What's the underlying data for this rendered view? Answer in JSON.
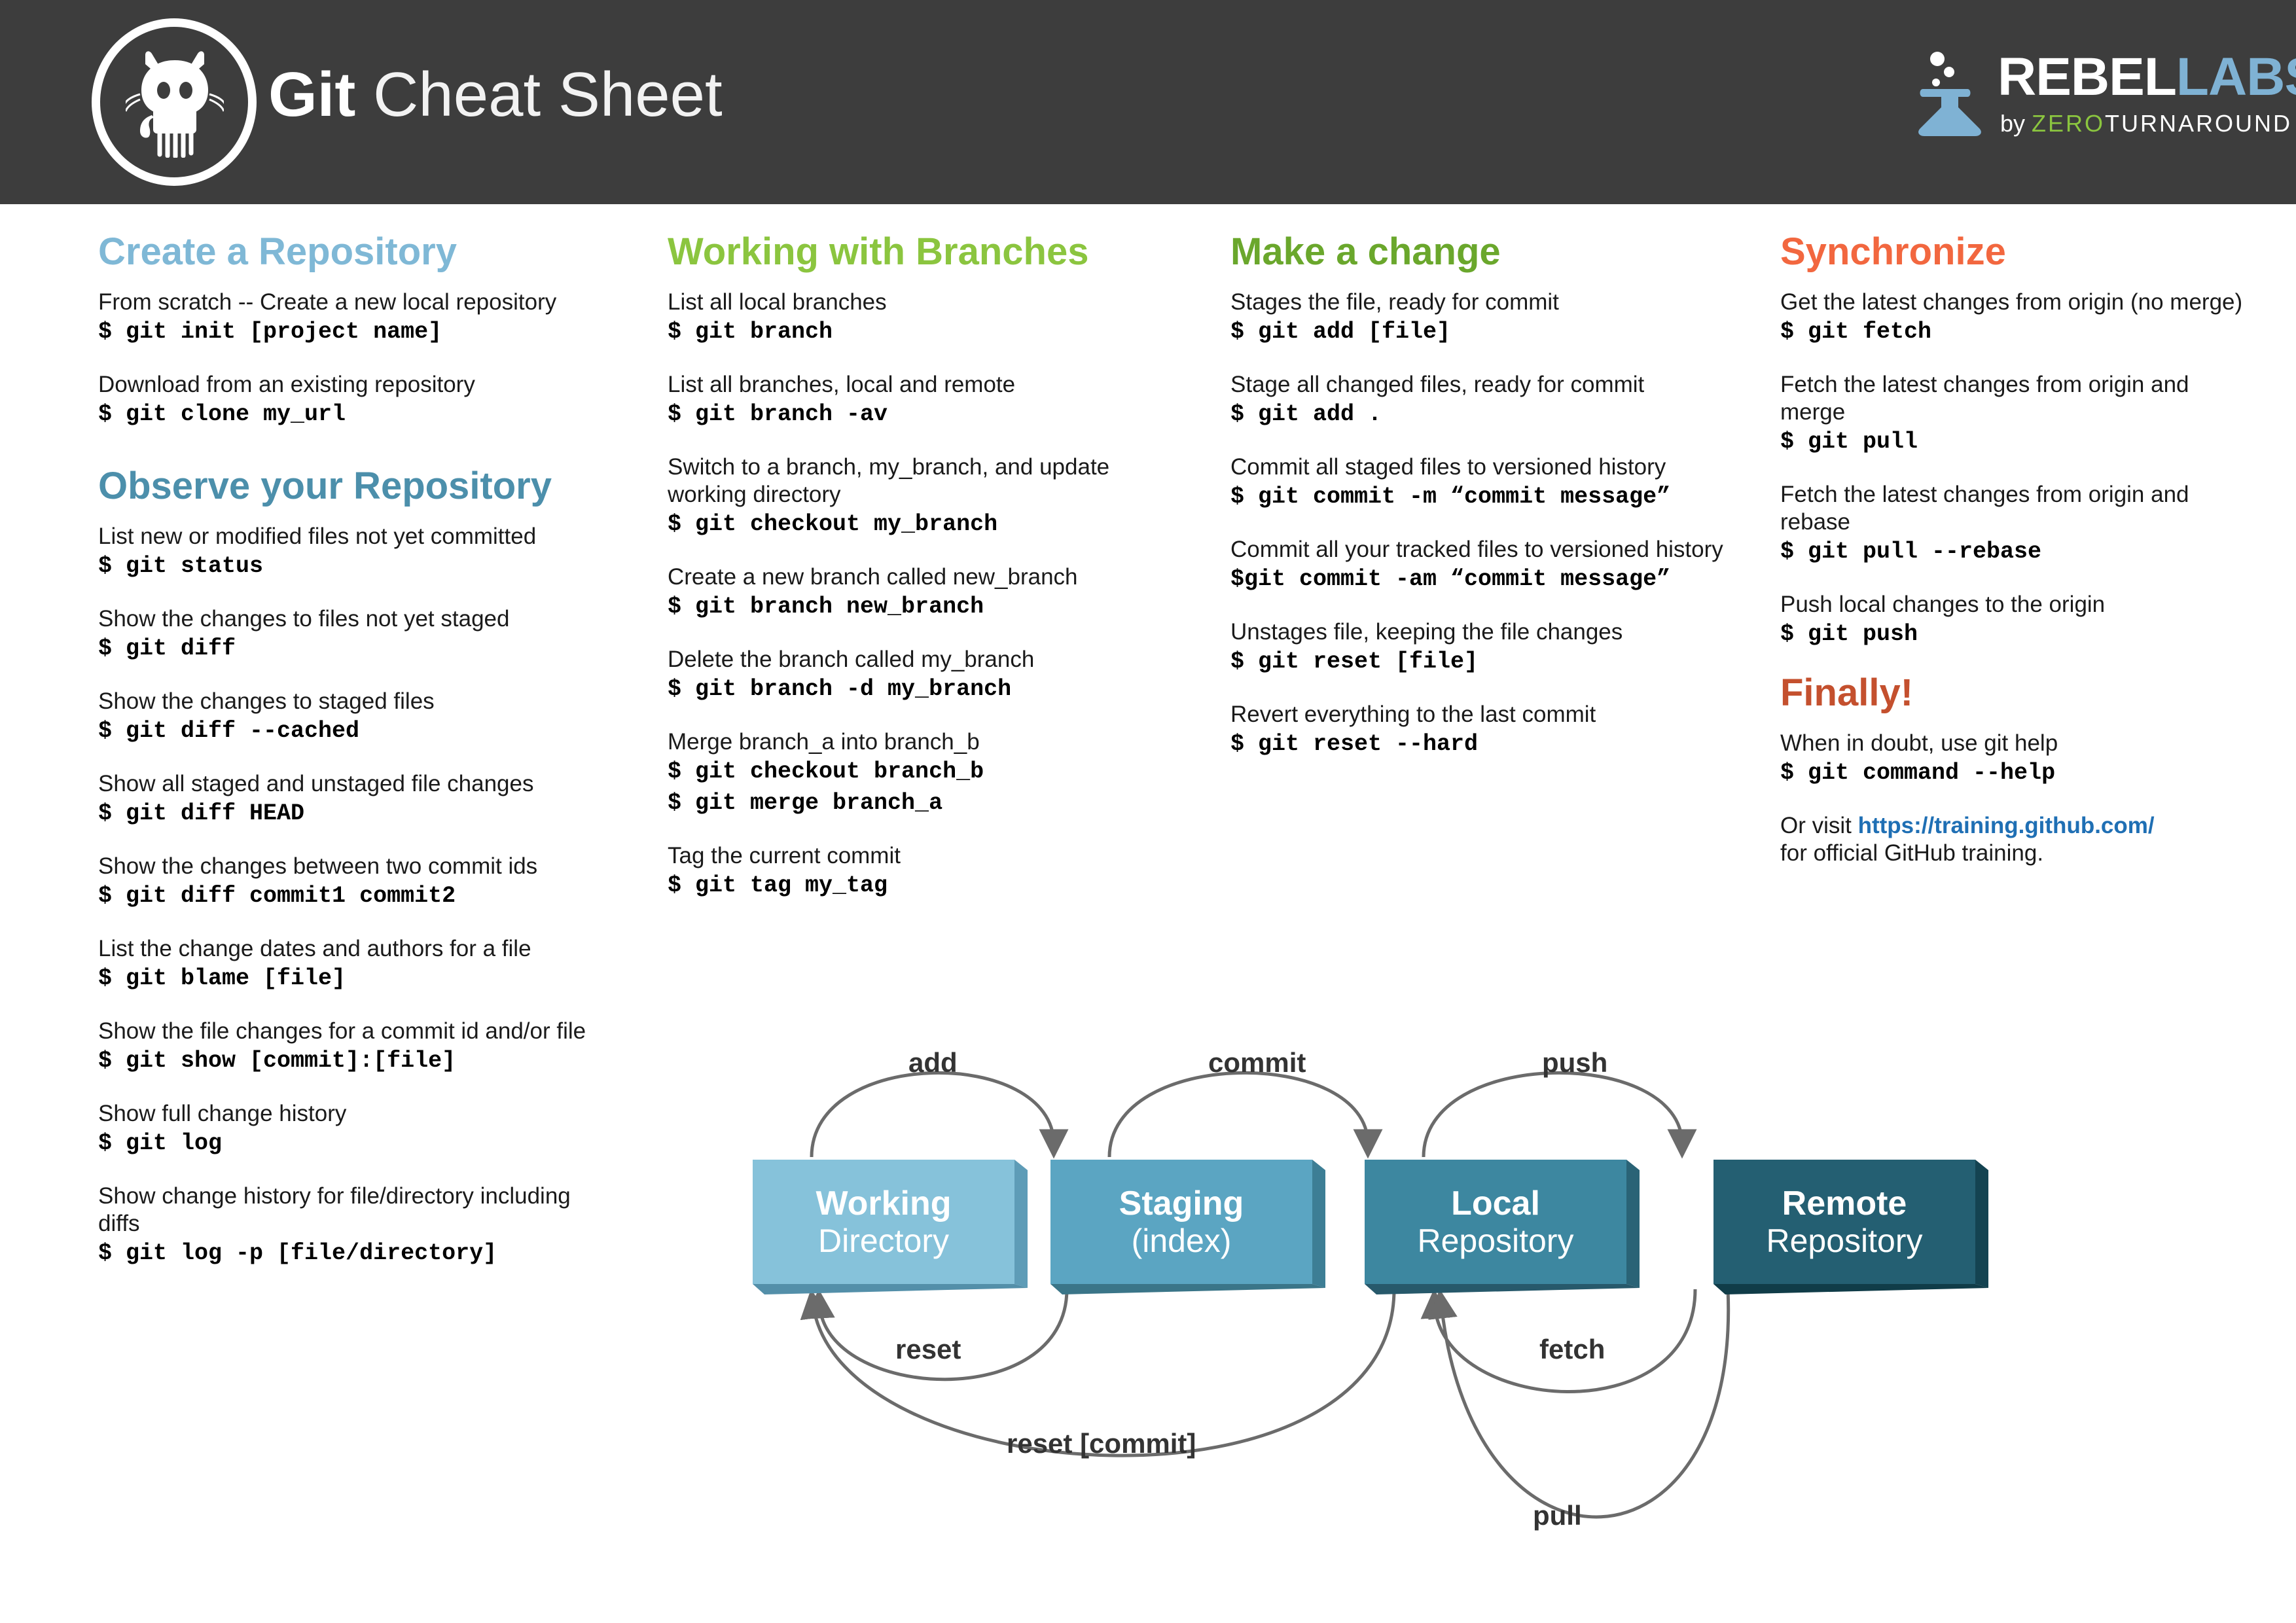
{
  "header": {
    "title_bold": "Git",
    "title_light": " Cheat Sheet",
    "logo_icon": "github-octocat-icon",
    "brand": {
      "rebel": "REBEL",
      "labs": "LABS",
      "by": "by ",
      "zero": "ZERO",
      "turnaround": "TURNAROUND"
    }
  },
  "columns": [
    {
      "id": "create-repository",
      "sections": [
        {
          "heading": "Create a Repository",
          "color": "#7fb8d6",
          "blocks": [
            {
              "desc": "From scratch -- Create a new local repository",
              "cmd": "$ git init [project name]"
            },
            {
              "desc": "Download from an existing repository",
              "cmd": "$ git clone my_url"
            }
          ]
        },
        {
          "heading": "Observe your Repository",
          "color": "#4c8fab",
          "blocks": [
            {
              "desc": "List new or modified files not yet committed",
              "cmd": "$ git status"
            },
            {
              "desc": "Show the changes to files not yet staged",
              "cmd": "$ git diff"
            },
            {
              "desc": "Show the changes to staged files",
              "cmd": "$ git diff --cached"
            },
            {
              "desc": "Show all staged and unstaged file changes",
              "cmd": "$ git diff HEAD"
            },
            {
              "desc": "Show the changes between two commit ids",
              "cmd": "$ git diff commit1 commit2"
            },
            {
              "desc": "List the change dates and authors for a file",
              "cmd": "$ git blame [file]"
            },
            {
              "desc": "Show the file changes for a commit id and/or file",
              "cmd": "$ git show [commit]:[file]"
            },
            {
              "desc": "Show full change history",
              "cmd": "$ git log"
            },
            {
              "desc": "Show change history for file/directory including diffs",
              "cmd": "$ git log -p [file/directory]"
            }
          ]
        }
      ]
    },
    {
      "id": "working-with-branches",
      "sections": [
        {
          "heading": "Working with Branches",
          "color": "#8bc53f",
          "blocks": [
            {
              "desc": "List all local branches",
              "cmd": "$ git branch"
            },
            {
              "desc": "List all branches, local and remote",
              "cmd": "$ git branch -av"
            },
            {
              "desc": "Switch to a branch, my_branch, and update working directory",
              "cmd": "$ git checkout my_branch"
            },
            {
              "desc": "Create a new branch called new_branch",
              "cmd": "$ git branch new_branch"
            },
            {
              "desc": "Delete the branch called my_branch",
              "cmd": "$ git branch -d my_branch"
            },
            {
              "desc": "Merge branch_a into branch_b",
              "cmd": "$ git checkout branch_b\n$ git merge branch_a"
            },
            {
              "desc": "Tag the current commit",
              "cmd": "$ git tag my_tag"
            }
          ]
        }
      ]
    },
    {
      "id": "make-a-change",
      "sections": [
        {
          "heading": "Make a change",
          "color": "#6aa72c",
          "blocks": [
            {
              "desc": "Stages the file, ready for commit",
              "cmd": "$ git add [file]"
            },
            {
              "desc": "Stage all changed files, ready for commit",
              "cmd": "$ git add ."
            },
            {
              "desc": "Commit all staged files to versioned history",
              "cmd": "$ git commit -m “commit message”"
            },
            {
              "desc": "Commit all your tracked files to versioned history",
              "cmd": "$git commit -am “commit message”"
            },
            {
              "desc": "Unstages file, keeping the file changes",
              "cmd": "$ git reset [file]"
            },
            {
              "desc": "Revert everything to the last commit",
              "cmd": "$ git reset --hard"
            }
          ]
        }
      ]
    },
    {
      "id": "synchronize",
      "sections": [
        {
          "heading": "Synchronize",
          "color": "#f2673f",
          "blocks": [
            {
              "desc": "Get the latest changes from origin (no merge)",
              "cmd": "$ git fetch"
            },
            {
              "desc": "Fetch the latest changes from origin and merge",
              "cmd": "$ git pull"
            },
            {
              "desc": "Fetch the latest changes from origin and rebase",
              "cmd": "$ git pull --rebase"
            },
            {
              "desc": "Push local changes to the origin",
              "cmd": "$ git push"
            }
          ]
        },
        {
          "heading": "Finally!",
          "color": "#c4502e",
          "blocks": [
            {
              "desc": "When in doubt, use git help",
              "cmd": "$ git command --help"
            }
          ],
          "footer": {
            "pre": "Or visit ",
            "link": "https://training.github.com/",
            "post": "for official GitHub training."
          }
        }
      ]
    }
  ],
  "diagram": {
    "nodes": [
      {
        "title": "Working",
        "subtitle": "Directory",
        "color": "#86c2da",
        "side": "#6aa8c2",
        "bottom": "#5e9cb7"
      },
      {
        "title": "Staging",
        "subtitle": "(index)",
        "color": "#5ba5c2",
        "side": "#45899f",
        "bottom": "#3d7e95"
      },
      {
        "title": "Local",
        "subtitle": "Repository",
        "color": "#3d87a0",
        "side": "#2e6d82",
        "bottom": "#2a6376"
      },
      {
        "title": "Remote",
        "subtitle": "Repository",
        "color": "#245f72",
        "side": "#184a5a",
        "bottom": "#144351"
      }
    ],
    "arrows": [
      {
        "label": "add"
      },
      {
        "label": "commit"
      },
      {
        "label": "push"
      },
      {
        "label": "reset"
      },
      {
        "label": "fetch"
      },
      {
        "label": "reset [commit]"
      },
      {
        "label": "pull"
      }
    ]
  }
}
